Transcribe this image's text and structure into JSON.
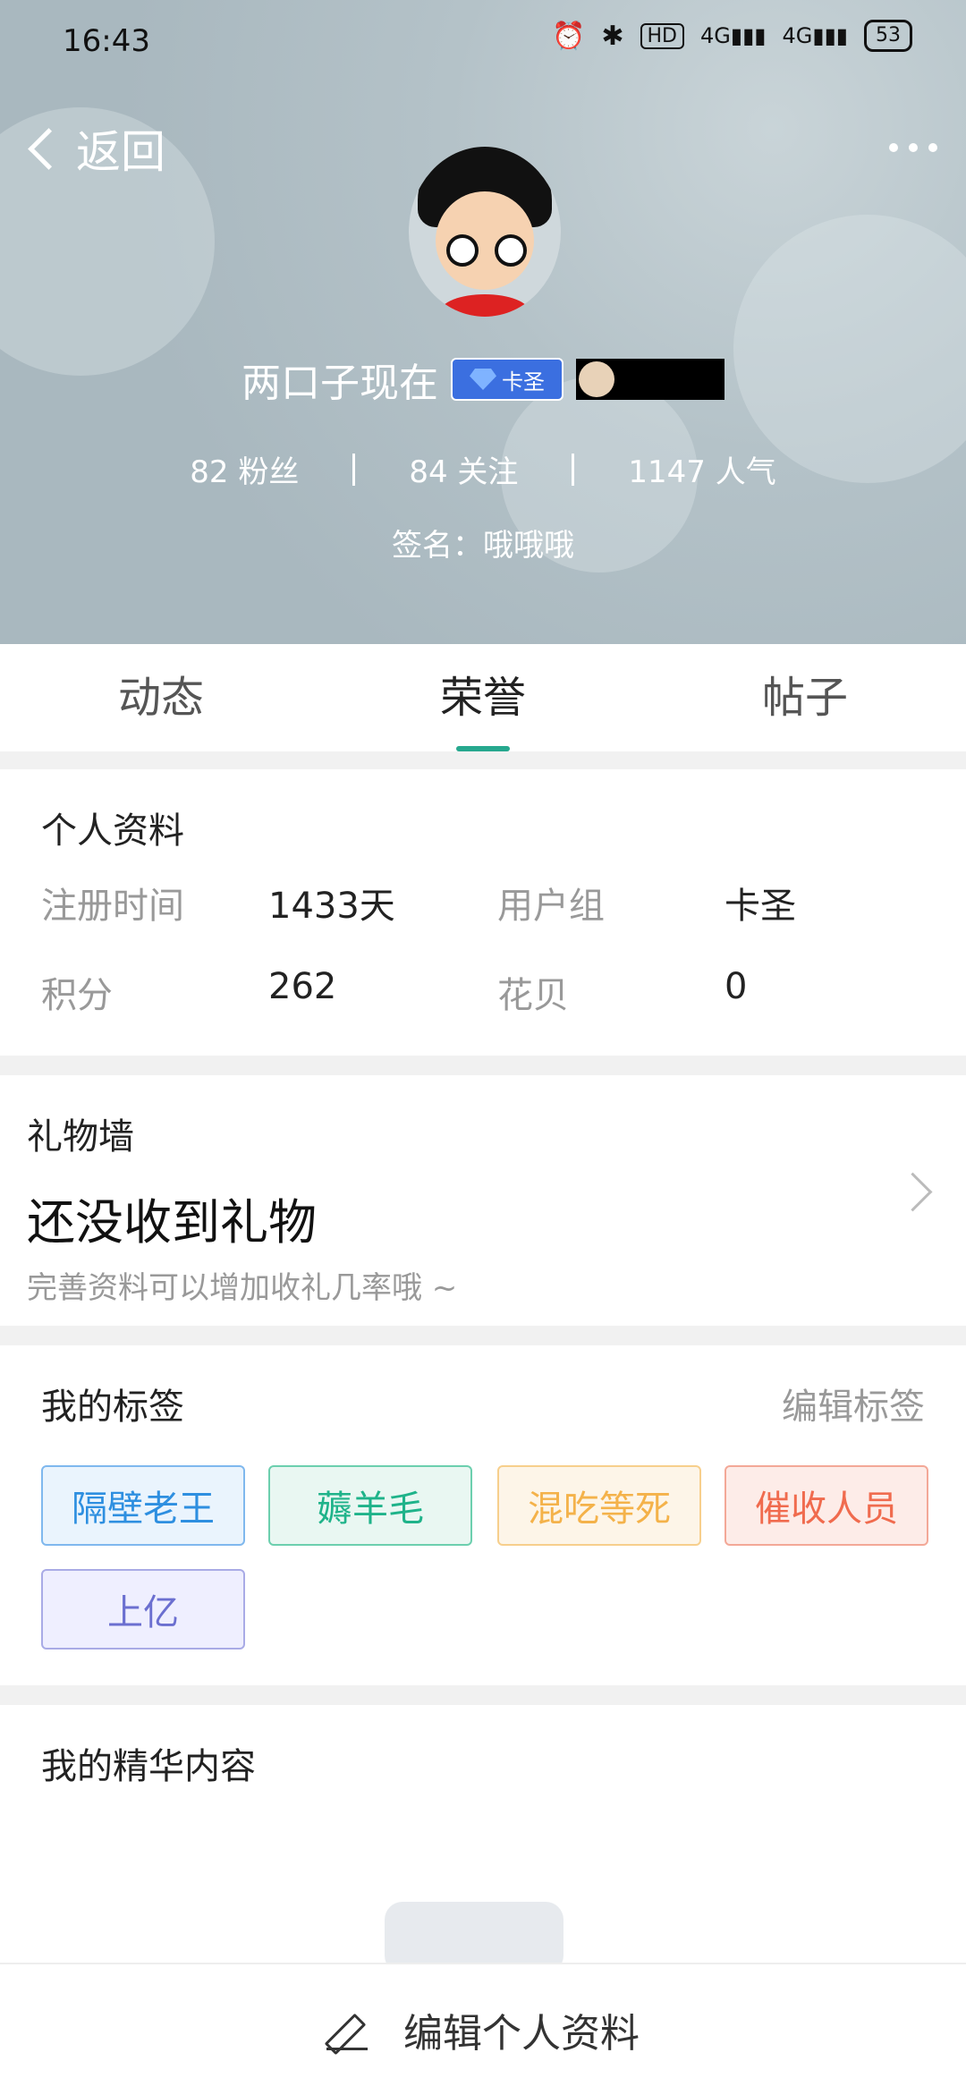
{
  "status_bar": {
    "time": "16:43",
    "icons": [
      "alarm-icon",
      "bluetooth-icon",
      "hd-icon",
      "signal-4g-icon",
      "signal-4g-icon"
    ],
    "battery": "53"
  },
  "header": {
    "back_label": "返回",
    "name": "两口子现在",
    "badge_label": "卡圣",
    "stats": {
      "fans": "82 粉丝",
      "following": "84 关注",
      "popularity": "1147 人气"
    },
    "signature": "签名：哦哦哦"
  },
  "tabs": [
    {
      "label": "动态"
    },
    {
      "label": "荣誉"
    },
    {
      "label": "帖子"
    }
  ],
  "profile": {
    "title": "个人资料",
    "register_label": "注册时间",
    "register_value": "1433天",
    "group_label": "用户组",
    "group_value": "卡圣",
    "points_label": "积分",
    "points_value": "262",
    "shells_label": "花贝",
    "shells_value": "0"
  },
  "gift_wall": {
    "title": "礼物墙",
    "headline": "还没收到礼物",
    "subtitle": "完善资料可以增加收礼几率哦 ~"
  },
  "tags": {
    "title": "我的标签",
    "edit_label": "编辑标签",
    "items": [
      {
        "label": "隔壁老王",
        "color": "#2e8fe0"
      },
      {
        "label": "薅羊毛",
        "color": "#1fb38a"
      },
      {
        "label": "混吃等死",
        "color": "#f4b24a"
      },
      {
        "label": "催收人员",
        "color": "#f06b4e"
      },
      {
        "label": "上亿",
        "color": "#6b6fd0"
      }
    ]
  },
  "essence": {
    "title": "我的精华内容"
  },
  "bottom": {
    "edit_profile_label": "编辑个人资料"
  }
}
